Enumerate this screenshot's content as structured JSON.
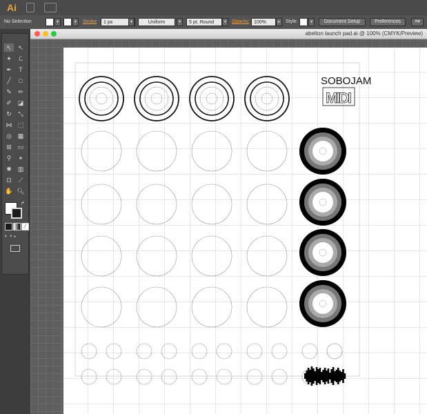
{
  "app": {
    "logo": "Ai"
  },
  "control_bar": {
    "selection_label": "No Selection",
    "stroke_label": "Stroke",
    "stroke_weight": "1 px",
    "profile": "Uniform",
    "brush": "5 pt. Round",
    "opacity_label": "Opacity:",
    "opacity_value": "100%",
    "style_label": "Style:",
    "document_setup": "Document Setup",
    "preferences": "Preferences"
  },
  "document": {
    "title": "abelton launch pad.ai @ 100% (CMYK/Preview)"
  },
  "artwork": {
    "logo_text": "SOBOJAM",
    "logo_sub": "MIDI"
  },
  "colors": {
    "app_bg": "#3a3a3a",
    "accent_link": "#f0a040",
    "artboard": "#ffffff"
  }
}
